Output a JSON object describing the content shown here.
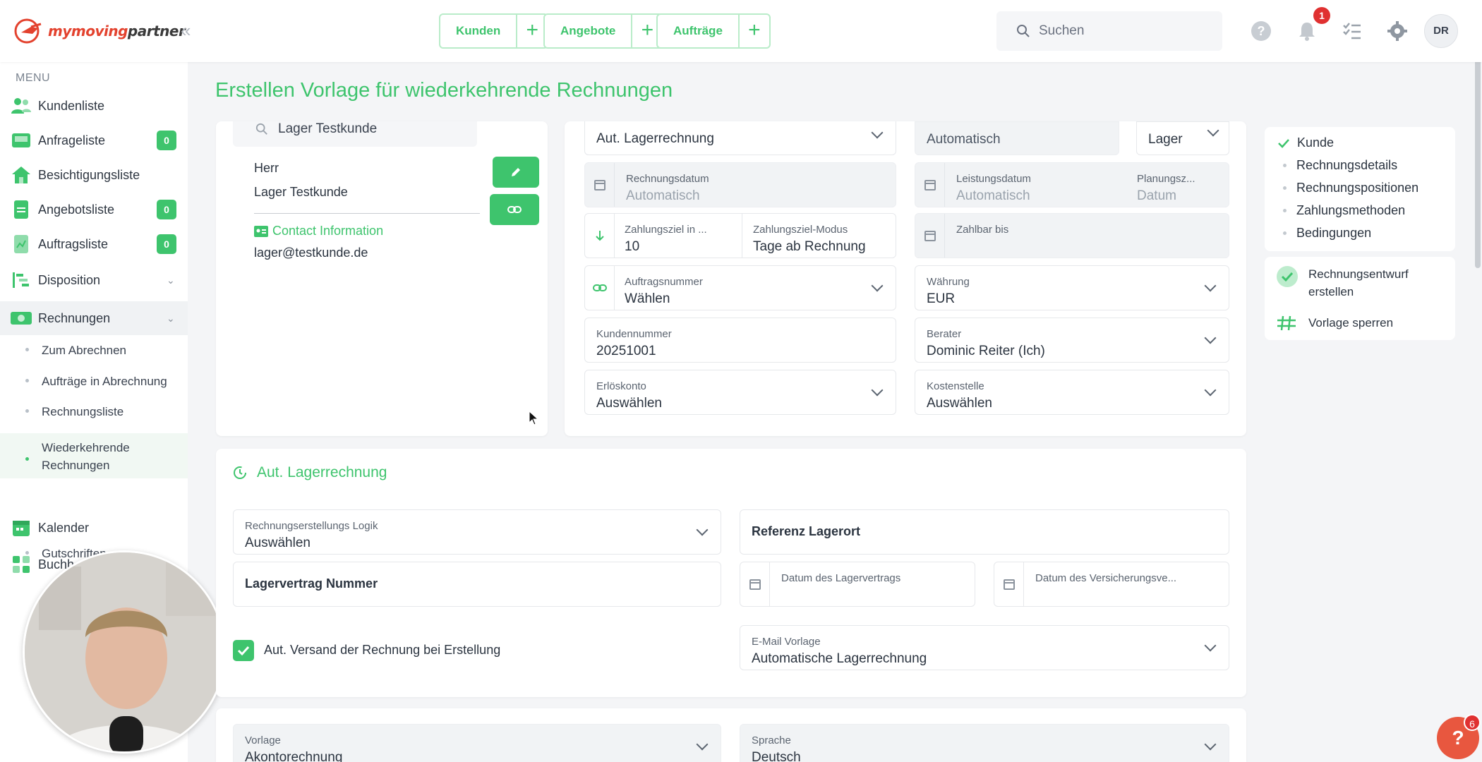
{
  "brand": {
    "name_prefix": "mymoving",
    "name_suffix": "partner",
    "accent": "#3ec46d"
  },
  "topbar": {
    "quick_actions": [
      {
        "label": "Kunden"
      },
      {
        "label": "Angebote"
      },
      {
        "label": "Aufträge"
      }
    ],
    "search_placeholder": "Suchen",
    "notification_count": "1",
    "avatar_initials": "DR"
  },
  "sidebar": {
    "menu_title": "MENU",
    "items": [
      {
        "label": "Kundenliste"
      },
      {
        "label": "Anfrageliste",
        "count": "0"
      },
      {
        "label": "Besichtigungsliste"
      },
      {
        "label": "Angebotsliste",
        "count": "0"
      },
      {
        "label": "Auftragsliste",
        "count": "0"
      },
      {
        "label": "Disposition"
      },
      {
        "label": "Rechnungen"
      },
      {
        "label": "Kalender"
      },
      {
        "label": "Buchh"
      }
    ],
    "sub_items": [
      {
        "label": "Zum Abrechnen"
      },
      {
        "label": "Aufträge in Abrechnung"
      },
      {
        "label": "Rechnungsliste"
      },
      {
        "label": "Wiederkehrende Rechnungen"
      },
      {
        "label": "Gutschriften"
      }
    ]
  },
  "page": {
    "title": "Erstellen Vorlage für wiederkehrende Rechnungen"
  },
  "customer_card": {
    "search_value": "Lager Testkunde",
    "salutation": "Herr",
    "name": "Lager Testkunde",
    "contact_heading": "Contact Information",
    "email": "lager@testkunde.de"
  },
  "invoice_details": {
    "invoice_type_value": "Aut. Lagerrechnung",
    "number_value": "Automatisch",
    "number_range_value": "Lager",
    "invoice_date": {
      "label": "Rechnungsdatum",
      "value": "Automatisch"
    },
    "service_date": {
      "label": "Leistungsdatum",
      "value": "Automatisch"
    },
    "planning": {
      "label": "Planungsz...",
      "value": "Datum"
    },
    "payment_term": {
      "label": "Zahlungsziel in ...",
      "value": "10"
    },
    "payment_mode": {
      "label": "Zahlungsziel-Modus",
      "value": "Tage ab Rechnung"
    },
    "payable_until": {
      "label": "Zahlbar bis",
      "value": ""
    },
    "order_number": {
      "label": "Auftragsnummer",
      "value": "Wählen"
    },
    "currency": {
      "label": "Währung",
      "value": "EUR"
    },
    "customer_number": {
      "label": "Kundennummer",
      "value": "20251001"
    },
    "advisor": {
      "label": "Berater",
      "value": "Dominic Reiter (Ich)"
    },
    "revenue_account": {
      "label": "Erlöskonto",
      "value": "Auswählen"
    },
    "cost_center": {
      "label": "Kostenstelle",
      "value": "Auswählen"
    }
  },
  "steps": {
    "items": [
      {
        "label": "Kunde"
      },
      {
        "label": "Rechnungsdetails"
      },
      {
        "label": "Rechnungspositionen"
      },
      {
        "label": "Zahlungsmethoden"
      },
      {
        "label": "Bedingungen"
      }
    ],
    "create_draft_line1": "Rechnungsentwurf",
    "create_draft_line2": "erstellen",
    "lock_template": "Vorlage sperren"
  },
  "storage_section": {
    "title": "Aut. Lagerrechnung",
    "logic": {
      "label": "Rechnungserstellungs Logik",
      "value": "Auswählen"
    },
    "reference_location": "Referenz Lagerort",
    "contract_number": "Lagervertrag Nummer",
    "contract_date": {
      "label": "Datum des Lagervertrags",
      "value": ""
    },
    "insurance_date": {
      "label": "Datum des Versicherungsve...",
      "value": ""
    },
    "auto_send_label": "Aut. Versand der Rechnung bei Erstellung",
    "auto_send_checked": true,
    "email_template": {
      "label": "E-Mail Vorlage",
      "value": "Automatische Lagerrechnung"
    }
  },
  "template_section": {
    "template": {
      "label": "Vorlage",
      "value": "Akontorechnung"
    },
    "language": {
      "label": "Sprache",
      "value": "Deutsch"
    }
  },
  "help_badge": "6",
  "help_label": "?"
}
